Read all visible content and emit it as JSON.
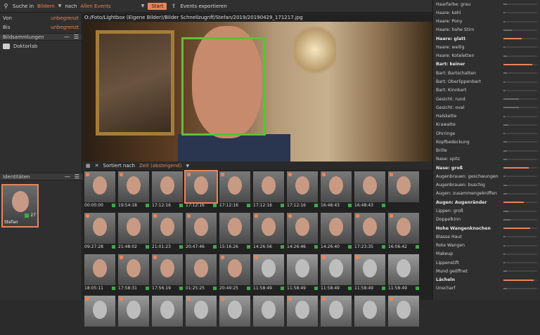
{
  "toolbar": {
    "search_in_label": "Suche in",
    "search_in_value": "Bildern",
    "after_label": "nach",
    "events_value": "Allen Events",
    "start_label": "Start",
    "export_label": "Events exportieren"
  },
  "left": {
    "von_label": "Von",
    "von_value": "unbegrenzt",
    "bis_label": "Bis",
    "bis_value": "unbegrenzt",
    "collections_title": "Bildsammlungen",
    "collection_item": "Doktorlab",
    "identities_title": "Identitäten",
    "identity_name": "Stefan",
    "identity_count": "27"
  },
  "center": {
    "path": "O:/Foto/Lightbox (Eigene Bilder)/Bilder Schnellzugriff/Stefan/2019/20190429_171217.jpg",
    "sort_label": "Sortiert nach",
    "sort_value": "Zeit (absteigend)",
    "thumbs": [
      {
        "t": "00:00:00",
        "bw": false
      },
      {
        "t": "19:54:18",
        "bw": false
      },
      {
        "t": "17:12:16",
        "bw": false
      },
      {
        "t": "17:12:16",
        "bw": false,
        "sel": true
      },
      {
        "t": "17:12:16",
        "bw": false
      },
      {
        "t": "17:12:16",
        "bw": false
      },
      {
        "t": "17:12:16",
        "bw": false
      },
      {
        "t": "16:48:43",
        "bw": false
      },
      {
        "t": "16:48:43",
        "bw": false
      },
      {
        "t": "",
        "bw": false
      },
      {
        "t": "09:27:28",
        "bw": false
      },
      {
        "t": "21:48:02",
        "bw": false
      },
      {
        "t": "21:01:23",
        "bw": false
      },
      {
        "t": "20:47:46",
        "bw": false
      },
      {
        "t": "15:16:26",
        "bw": false
      },
      {
        "t": "14:26:56",
        "bw": false
      },
      {
        "t": "14:26:46",
        "bw": false
      },
      {
        "t": "14:26:40",
        "bw": false
      },
      {
        "t": "17:23:35",
        "bw": false
      },
      {
        "t": "16:06:42",
        "bw": false
      },
      {
        "t": "18:05:11",
        "bw": false
      },
      {
        "t": "17:58:31",
        "bw": false
      },
      {
        "t": "17:56:19",
        "bw": false
      },
      {
        "t": "01:25:25",
        "bw": false
      },
      {
        "t": "20:49:25",
        "bw": false
      },
      {
        "t": "11:58:49",
        "bw": true
      },
      {
        "t": "11:58:49",
        "bw": true
      },
      {
        "t": "11:58:49",
        "bw": true
      },
      {
        "t": "11:58:49",
        "bw": true
      },
      {
        "t": "11:58:49",
        "bw": true
      },
      {
        "t": "",
        "bw": true
      },
      {
        "t": "",
        "bw": true
      },
      {
        "t": "",
        "bw": true
      },
      {
        "t": "",
        "bw": true
      },
      {
        "t": "",
        "bw": true
      },
      {
        "t": "",
        "bw": true
      },
      {
        "t": "",
        "bw": true
      },
      {
        "t": "",
        "bw": true
      },
      {
        "t": "",
        "bw": true
      },
      {
        "t": "",
        "bw": true
      }
    ]
  },
  "attributes": [
    {
      "n": "Haarfarbe: grau",
      "v": 0.1,
      "b": false
    },
    {
      "n": "Haare: kahl",
      "v": 0.05,
      "b": false
    },
    {
      "n": "Haare: Pony",
      "v": 0.05,
      "b": false
    },
    {
      "n": "Haare: hohe Stirn",
      "v": 0.25,
      "b": false
    },
    {
      "n": "Haare: glatt",
      "v": 0.55,
      "b": true
    },
    {
      "n": "Haare: wellig",
      "v": 0.05,
      "b": false
    },
    {
      "n": "Haare: Koteletten",
      "v": 0.1,
      "b": false
    },
    {
      "n": "Bart: keiner",
      "v": 0.85,
      "b": true
    },
    {
      "n": "Bart: Bartschatten",
      "v": 0.1,
      "b": false
    },
    {
      "n": "Bart: Oberlippenbart",
      "v": 0.05,
      "b": false
    },
    {
      "n": "Bart: Kinnbart",
      "v": 0.05,
      "b": false
    },
    {
      "n": "Gesicht: rund",
      "v": 0.45,
      "b": false
    },
    {
      "n": "Gesicht: oval",
      "v": 0.45,
      "b": false
    },
    {
      "n": "Halskette",
      "v": 0.05,
      "b": false
    },
    {
      "n": "Krawatte",
      "v": 0.15,
      "b": false
    },
    {
      "n": "Ohrringe",
      "v": 0.05,
      "b": false
    },
    {
      "n": "Kopfbedeckung",
      "v": 0.1,
      "b": false
    },
    {
      "n": "Brille",
      "v": 0.1,
      "b": false
    },
    {
      "n": "Nase: spitz",
      "v": 0.1,
      "b": false
    },
    {
      "n": "Nase: groß",
      "v": 0.75,
      "b": true
    },
    {
      "n": "Augenbrauen: geschwungen",
      "v": 0.05,
      "b": false
    },
    {
      "n": "Augenbrauen: buschig",
      "v": 0.1,
      "b": false
    },
    {
      "n": "Augen: zusammengekniffen",
      "v": 0.1,
      "b": false
    },
    {
      "n": "Augen: Augenränder",
      "v": 0.6,
      "b": true
    },
    {
      "n": "Lippen: groß",
      "v": 0.15,
      "b": false
    },
    {
      "n": "Doppelkinn",
      "v": 0.2,
      "b": false
    },
    {
      "n": "Hohe Wangenknochen",
      "v": 0.8,
      "b": true
    },
    {
      "n": "Blasse Haut",
      "v": 0.05,
      "b": false
    },
    {
      "n": "Rote Wangen",
      "v": 0.05,
      "b": false
    },
    {
      "n": "Makeup",
      "v": 0.05,
      "b": false
    },
    {
      "n": "Lippenstift",
      "v": 0.05,
      "b": false
    },
    {
      "n": "Mund geöffnet",
      "v": 0.1,
      "b": false
    },
    {
      "n": "Lächeln",
      "v": 0.9,
      "b": true
    },
    {
      "n": "Unscharf",
      "v": 0.1,
      "b": false
    }
  ],
  "colors": {
    "accent": "#e8845a",
    "face_box": "#5fc036",
    "badge": "#3caa4a"
  }
}
